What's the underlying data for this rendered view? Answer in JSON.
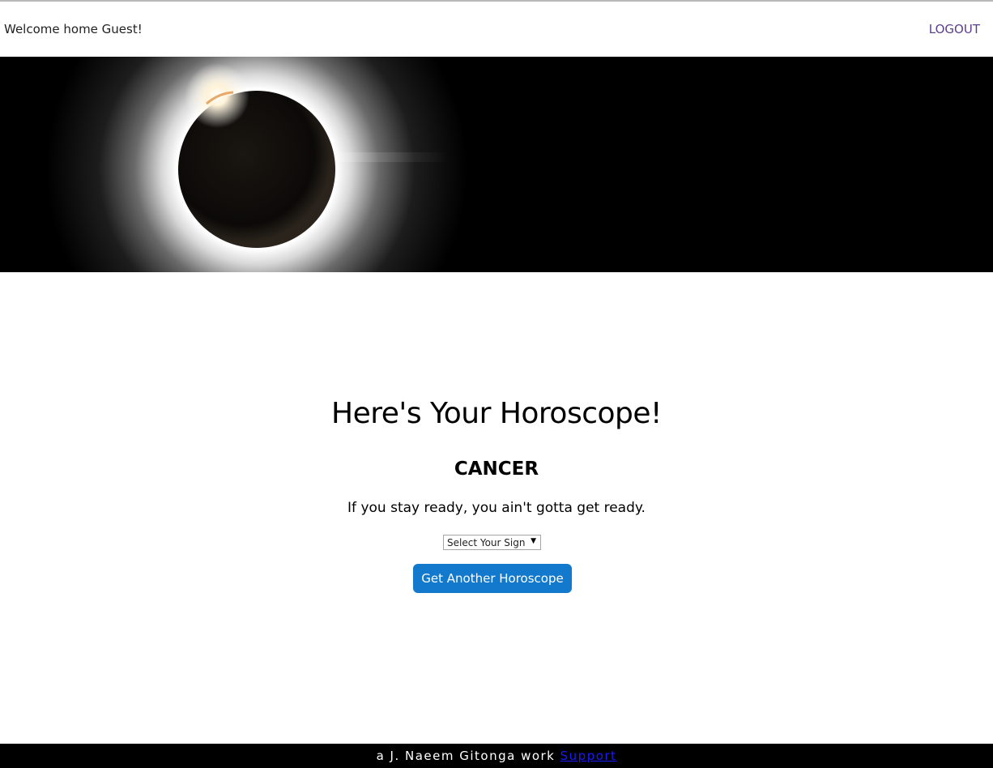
{
  "navbar": {
    "welcome_text": "Welcome home Guest!",
    "logout_label": "LOGOUT"
  },
  "hero": {
    "image_alt": "solar-eclipse-banner"
  },
  "main": {
    "title": "Here's Your Horoscope!",
    "sign": "CANCER",
    "message": "If you stay ready, you ain't gotta get ready.",
    "select": {
      "selected": "Select Your Sign"
    },
    "button_label": "Get Another Horoscope"
  },
  "footer": {
    "credit": "a J. Naeem Gitonga work ",
    "support_label": "Support"
  },
  "colors": {
    "logout": "#5b3e8e",
    "button": "#1379cc",
    "footer_bg": "#000000",
    "support_link": "#1a1aff"
  }
}
